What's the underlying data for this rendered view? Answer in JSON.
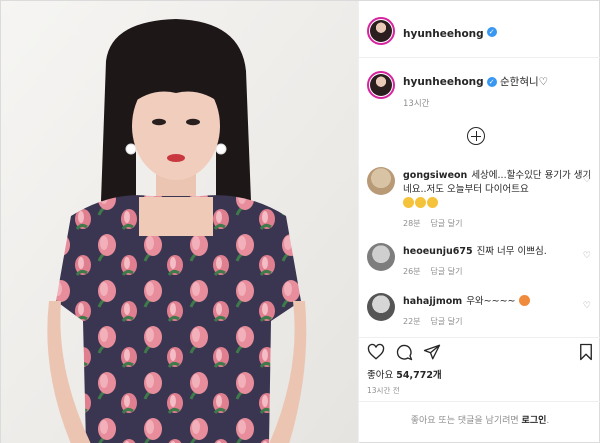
{
  "post": {
    "username": "hyunheehong",
    "caption": "순한혀니♡",
    "caption_time": "13시간",
    "likes_label": "좋아요",
    "likes_count": "54,772개",
    "post_time": "13시간 전"
  },
  "comments": [
    {
      "user": "gongsiweon",
      "text": "세상에...할수있단 용기가 생기네요..저도 오늘부터 다이어트요",
      "age": "28분",
      "reply": "답글 달기"
    },
    {
      "user": "heoeunju675",
      "text": "진짜 너무 이쁘심.",
      "age": "26분",
      "reply": "답글 달기"
    },
    {
      "user": "hahajjmom",
      "text": "우와~~~~",
      "age": "22분",
      "reply": "답글 달기"
    }
  ],
  "footer": {
    "prompt": "좋아요 또는 댓글을 남기려면",
    "login_link": "로그인",
    "period": "."
  },
  "icons": {
    "verified": "verified-badge-icon",
    "load_more": "plus-circle-icon",
    "like": "heart-icon",
    "comment": "comment-icon",
    "share": "paper-plane-icon",
    "save": "bookmark-icon"
  },
  "colors": {
    "accent_blue": "#3897f0",
    "story_ring": "#d6249f",
    "meta_gray": "#8e8e8e"
  }
}
